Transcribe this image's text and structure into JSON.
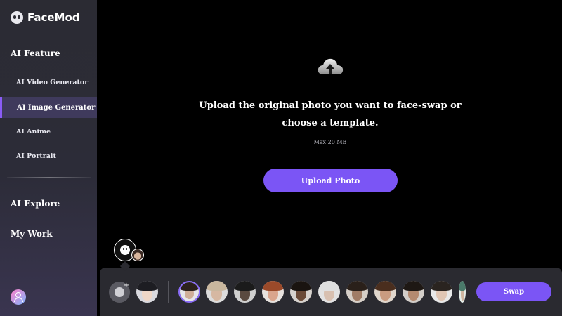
{
  "app": {
    "name": "FaceMod"
  },
  "sidebar": {
    "sections": [
      {
        "title": "AI Feature"
      },
      {
        "title": "AI Explore"
      },
      {
        "title": "My Work"
      }
    ],
    "items": [
      {
        "label": "AI Video Generator",
        "active": false
      },
      {
        "label": "AI Image Generator",
        "active": true
      },
      {
        "label": "AI Anime",
        "active": false
      },
      {
        "label": "AI Portrait",
        "active": false
      }
    ],
    "avatar_icon": "user-icon"
  },
  "upload": {
    "icon": "cloud-upload-icon",
    "instruction": "Upload the original photo you want to face-swap or choose a template.",
    "max_size": "Max 20 MB",
    "button_label": "Upload Photo"
  },
  "tray": {
    "add_icon": "add-face-icon",
    "swap_label": "Swap",
    "thumbnails": [
      {
        "kind": "anime",
        "selected": false
      },
      {
        "kind": "face",
        "selected": true
      },
      {
        "kind": "face",
        "selected": false
      },
      {
        "kind": "face",
        "selected": false
      },
      {
        "kind": "face",
        "selected": false
      },
      {
        "kind": "face",
        "selected": false
      },
      {
        "kind": "face",
        "selected": false
      },
      {
        "kind": "face",
        "selected": false
      },
      {
        "kind": "face",
        "selected": false
      },
      {
        "kind": "face",
        "selected": false
      },
      {
        "kind": "face",
        "selected": false
      },
      {
        "kind": "face",
        "selected": false
      }
    ]
  },
  "colors": {
    "accent": "#7b55f5",
    "sidebar_active": "#3f3a5c",
    "tray": "#2a2a30"
  }
}
